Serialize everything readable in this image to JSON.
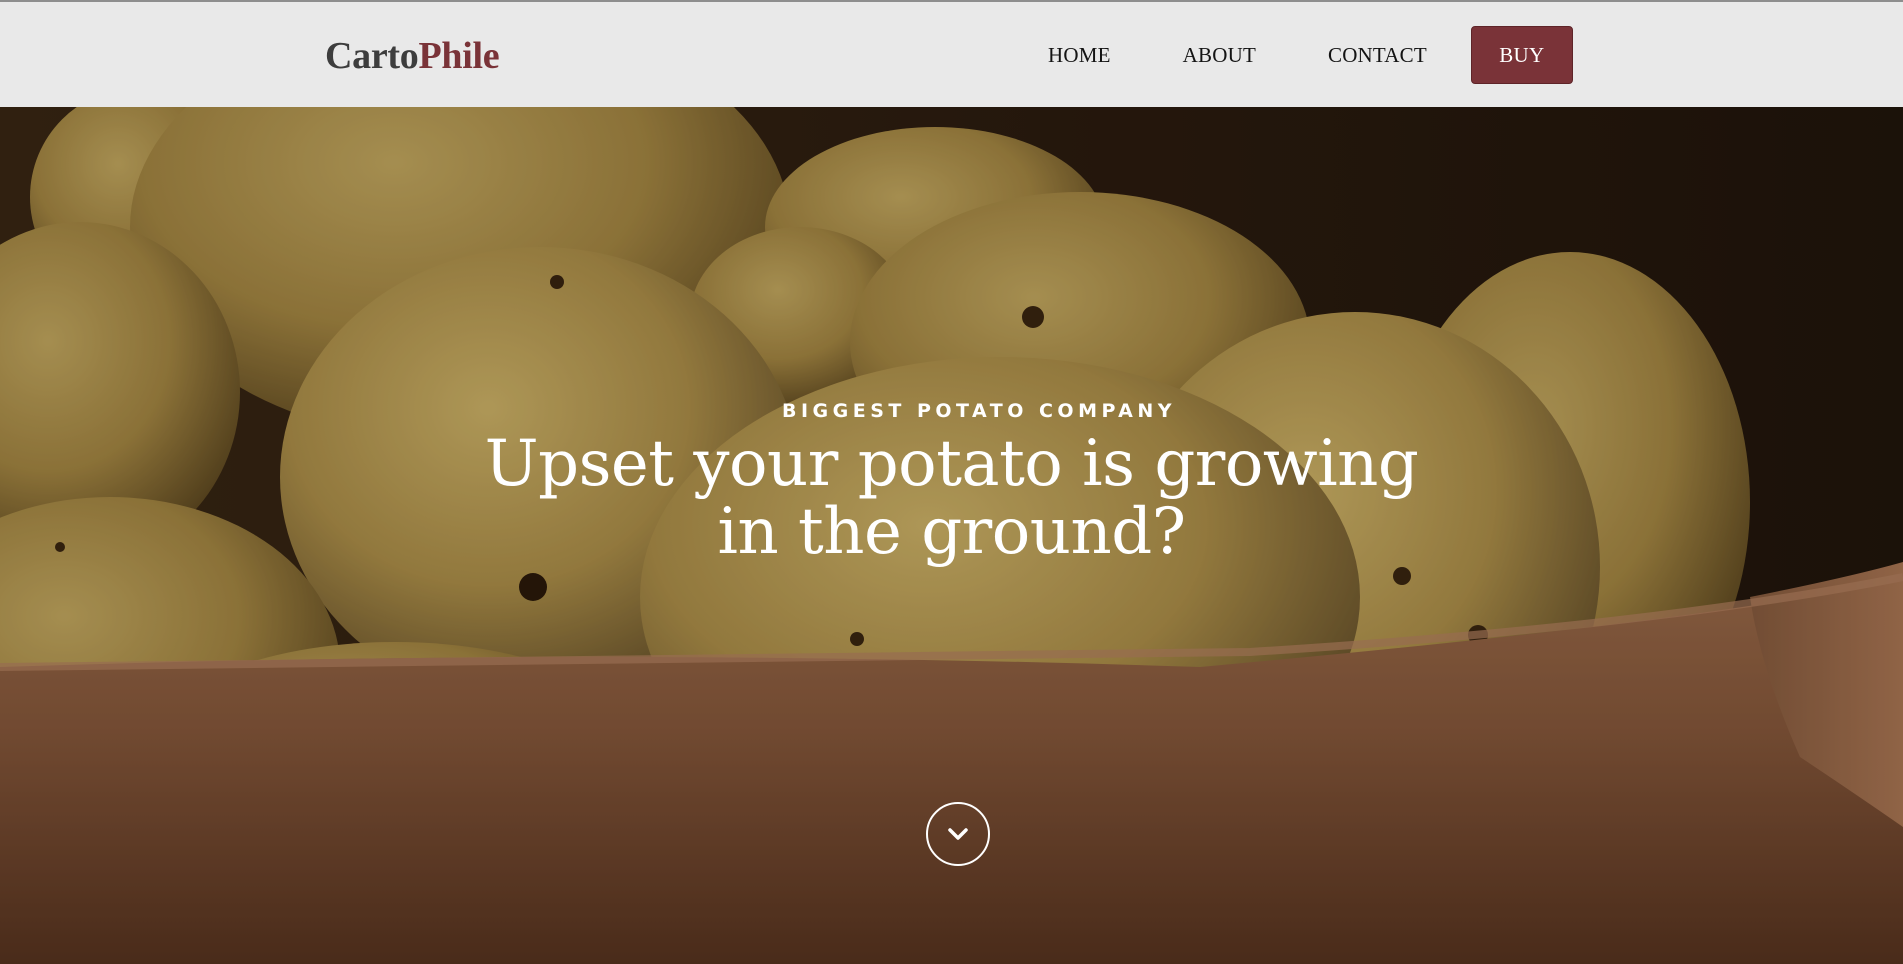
{
  "brand": {
    "logo_part1": "Carto",
    "logo_part2": "Phile",
    "accent_color": "#7a3338"
  },
  "nav": {
    "items": [
      {
        "label": "HOME"
      },
      {
        "label": "ABOUT"
      },
      {
        "label": "CONTACT"
      }
    ],
    "buy_label": "BUY"
  },
  "hero": {
    "kicker": "BIGGEST POTATO COMPANY",
    "headline": "Upset your potato is growing in the ground?",
    "background_image": "potatoes-in-clay-bowl",
    "scroll_icon": "chevron-down-icon"
  }
}
